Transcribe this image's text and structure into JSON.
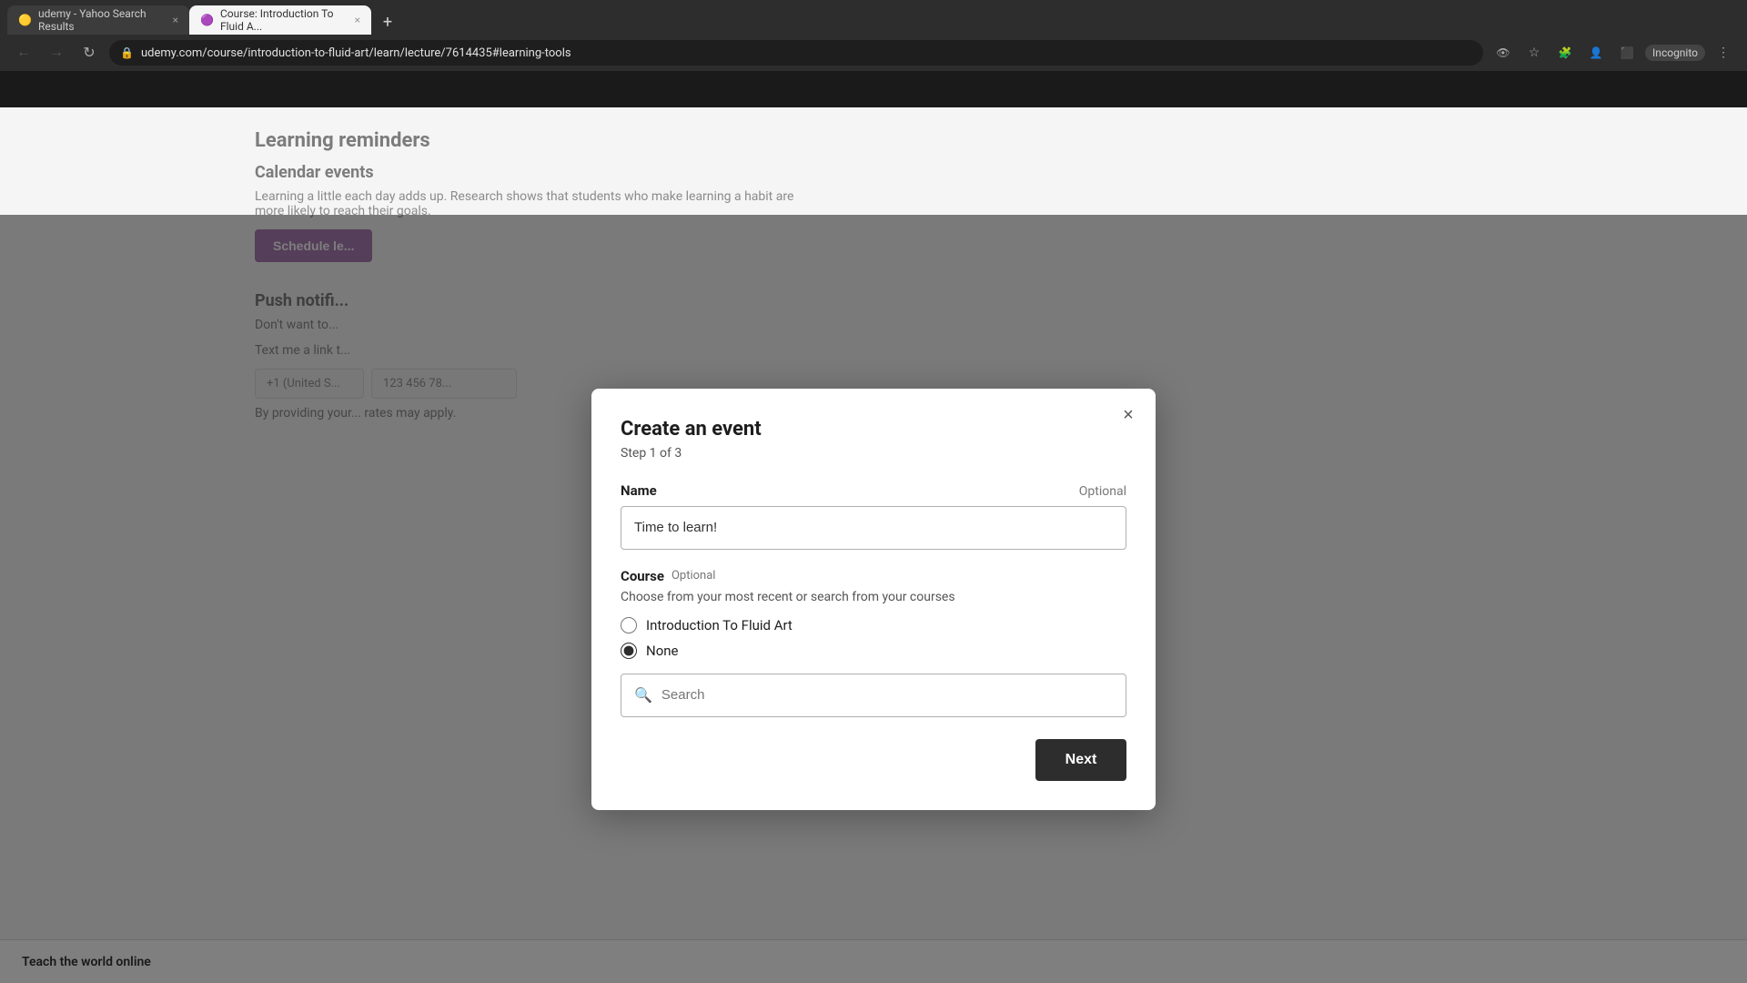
{
  "browser": {
    "tabs": [
      {
        "id": "tab1",
        "label": "udemy - Yahoo Search Results",
        "active": false,
        "favicon": "🟡"
      },
      {
        "id": "tab2",
        "label": "Course: Introduction To Fluid A...",
        "active": true,
        "favicon": "🟣"
      }
    ],
    "url": "udemy.com/course/introduction-to-fluid-art/learn/lecture/7614435#learning-tools",
    "nav": {
      "back": "←",
      "forward": "→",
      "refresh": "↻"
    },
    "incognito_label": "Incognito"
  },
  "page": {
    "section_title": "Learning reminders",
    "calendar_heading": "Calendar events",
    "calendar_text": "Learning a little each day adds up. Research shows that students who make learning a habit are more likely to reach their goals.",
    "schedule_btn_label": "Schedule le...",
    "push_heading": "Push notifi...",
    "push_text": "Don't want to...",
    "text_label": "Text me a link t...",
    "phone_placeholder": "+1 (United S...",
    "phone_number_placeholder": "123 456 78...",
    "disclaimer": "By providing your... rates may apply."
  },
  "modal": {
    "title": "Create an event",
    "close_icon": "×",
    "step_label": "Step 1 of 3",
    "name_label": "Name",
    "name_optional": "Optional",
    "name_placeholder": "Time to learn!",
    "name_value": "Time to learn!",
    "course_label": "Course",
    "course_optional": "Optional",
    "course_hint": "Choose from your most recent or search from your courses",
    "radio_options": [
      {
        "id": "intro-fluid",
        "label": "Introduction To Fluid Art",
        "checked": false
      },
      {
        "id": "none",
        "label": "None",
        "checked": true
      }
    ],
    "search_placeholder": "Search",
    "next_btn_label": "Next"
  },
  "bottom_bar": {
    "text": "Teach the world online"
  },
  "icons": {
    "search": "🔍",
    "lock": "🔒",
    "star": "☆",
    "menu": "⋮"
  }
}
